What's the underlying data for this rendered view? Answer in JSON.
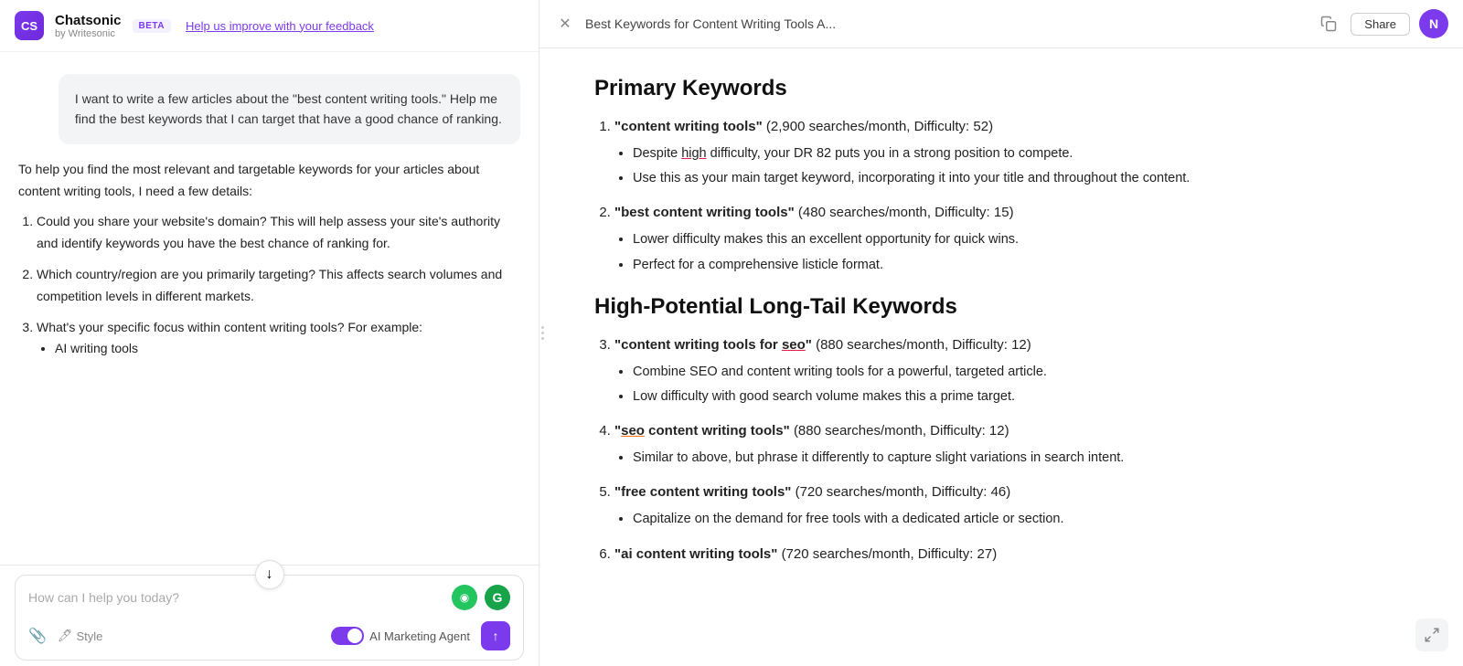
{
  "header": {
    "logo_initials": "CS",
    "logo_name": "Chatsonic",
    "logo_sub": "by Writesonic",
    "beta_label": "BETA",
    "feedback_text": "Help us improve with your feedback"
  },
  "chat": {
    "user_message": "I want to write a few articles about the \"best content writing tools.\" Help me find the best keywords that I can target that have a good chance of ranking.",
    "ai_intro": "To help you find the most relevant and targetable keywords for your articles about content writing tools, I need a few details:",
    "ai_questions": [
      "Could you share your website's domain? This will help assess your site's authority and identify keywords you have the best chance of ranking for.",
      "Which country/region are you primarily targeting? This affects search volumes and competition levels in different markets.",
      "What's your specific focus within content writing tools? For example:"
    ],
    "ai_bullets": [
      "AI writing tools"
    ]
  },
  "input": {
    "placeholder": "How can I help you today?",
    "style_label": "Style",
    "agent_label": "AI Marketing Agent",
    "send_icon": "↑"
  },
  "right_panel": {
    "tab_title": "Best Keywords for Content Writing Tools A...",
    "share_label": "Share",
    "avatar_label": "N"
  },
  "content": {
    "section1_title": "Primary Keywords",
    "keywords": [
      {
        "index": 1,
        "term": "\"content writing tools\"",
        "meta": " (2,900 searches/month, Difficulty: 52)",
        "bullets": [
          "Despite high difficulty, your DR 82 puts you in a strong position to compete.",
          "Use this as your main target keyword, incorporating it into your title and throughout the content."
        ]
      },
      {
        "index": 2,
        "term": "\"best content writing tools\"",
        "meta": " (480 searches/month, Difficulty: 15)",
        "bullets": [
          "Lower difficulty makes this an excellent opportunity for quick wins.",
          "Perfect for a comprehensive listicle format."
        ]
      }
    ],
    "section2_title": "High-Potential Long-Tail Keywords",
    "keywords2": [
      {
        "index": 3,
        "term": "\"content writing tools for seo\"",
        "meta": " (880 searches/month, Difficulty: 12)",
        "bullets": [
          "Combine SEO and content writing tools for a powerful, targeted article.",
          "Low difficulty with good search volume makes this a prime target."
        ]
      },
      {
        "index": 4,
        "term": "\"seo content writing tools\"",
        "meta": " (880 searches/month, Difficulty: 12)",
        "bullets": [
          "Similar to above, but phrase it differently to capture slight variations in search intent."
        ]
      },
      {
        "index": 5,
        "term": "\"free content writing tools\"",
        "meta": " (720 searches/month, Difficulty: 46)",
        "bullets": [
          "Capitalize on the demand for free tools with a dedicated article or section."
        ]
      },
      {
        "index": 6,
        "term": "\"ai content writing tools\"",
        "meta": " (720 searches/month, Difficulty: 27)",
        "bullets": []
      }
    ]
  }
}
